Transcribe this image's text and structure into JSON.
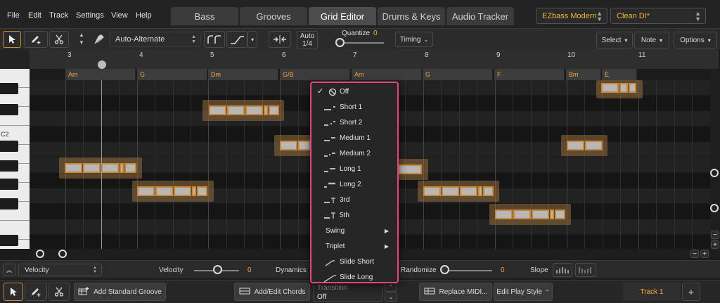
{
  "menu": [
    "File",
    "Edit",
    "Track",
    "Settings",
    "View",
    "Help"
  ],
  "tabs": [
    {
      "label": "Bass",
      "active": false
    },
    {
      "label": "Grooves",
      "active": false
    },
    {
      "label": "Grid Editor",
      "active": true
    },
    {
      "label": "Drums & Keys",
      "active": false
    },
    {
      "label": "Audio Tracker",
      "active": false
    }
  ],
  "presets": {
    "library": "EZbass Modern",
    "preset": "Clean DI*"
  },
  "toolbar": {
    "articulation": "Auto-Alternate",
    "auto_label": "Auto",
    "auto_value": "1/4",
    "quantize_label": "Quantize",
    "quantize_value": "0",
    "timing": "Timing",
    "select": "Select",
    "note": "Note",
    "options": "Options"
  },
  "ruler": {
    "bars": [
      "3",
      "4",
      "5",
      "6",
      "7",
      "8",
      "9",
      "10",
      "11"
    ],
    "chords": [
      "Am",
      "G",
      "Dm",
      "G/B",
      "Am",
      "G",
      "F",
      "Bm",
      "E"
    ]
  },
  "piano": {
    "c_label": "C2"
  },
  "dropdown": {
    "title": "Transition",
    "items": [
      {
        "label": "Off",
        "icon": "off-icon",
        "checked": true
      },
      {
        "label": "Short 1",
        "icon": "short1-icon"
      },
      {
        "label": "Short 2",
        "icon": "short2-icon"
      },
      {
        "label": "Medium 1",
        "icon": "medium1-icon"
      },
      {
        "label": "Medium 2",
        "icon": "medium2-icon"
      },
      {
        "label": "Long 1",
        "icon": "long1-icon"
      },
      {
        "label": "Long 2",
        "icon": "long2-icon"
      },
      {
        "label": "3rd",
        "icon": "third-icon"
      },
      {
        "label": "5th",
        "icon": "fifth-icon"
      },
      {
        "label": "Swing",
        "submenu": true
      },
      {
        "label": "Triplet",
        "submenu": true
      },
      {
        "label": "Slide Short",
        "icon": "slide-short-icon"
      },
      {
        "label": "Slide Long",
        "icon": "slide-long-icon"
      }
    ]
  },
  "controls": {
    "lane": "Velocity",
    "velocity_label": "Velocity",
    "velocity_value": "0",
    "dynamics_label": "Dynamics",
    "randomize_label": "Randomize",
    "randomize_value": "0",
    "slope_label": "Slope"
  },
  "bottom": {
    "add_groove": "Add Standard Groove",
    "add_chords": "Add/Edit Chords",
    "transition_label": "Transition",
    "transition_value": "Off",
    "replace_midi": "Replace MIDI...",
    "play_style": "Edit Play Style",
    "track": "Track 1",
    "add_track": "+"
  },
  "colors": {
    "accent": "#f2a93c",
    "highlight": "#e0457b",
    "note_fill": "#b7b7b7"
  }
}
